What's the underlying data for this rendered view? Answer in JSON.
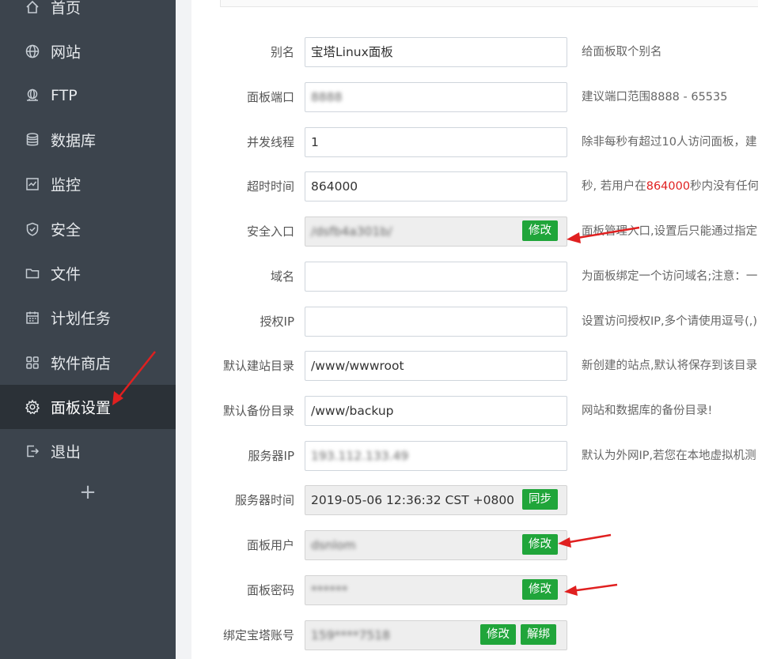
{
  "sidebar": {
    "items": [
      {
        "id": "home",
        "label": "首页",
        "icon": "home-icon"
      },
      {
        "id": "site",
        "label": "网站",
        "icon": "globe-icon"
      },
      {
        "id": "ftp",
        "label": "FTP",
        "icon": "ftp-icon"
      },
      {
        "id": "db",
        "label": "数据库",
        "icon": "database-icon"
      },
      {
        "id": "monitor",
        "label": "监控",
        "icon": "monitor-icon"
      },
      {
        "id": "security",
        "label": "安全",
        "icon": "shield-icon"
      },
      {
        "id": "files",
        "label": "文件",
        "icon": "folder-icon"
      },
      {
        "id": "cron",
        "label": "计划任务",
        "icon": "calendar-icon"
      },
      {
        "id": "store",
        "label": "软件商店",
        "icon": "grid-icon"
      },
      {
        "id": "settings",
        "label": "面板设置",
        "icon": "gear-icon",
        "active": true
      },
      {
        "id": "logout",
        "label": "退出",
        "icon": "logout-icon"
      }
    ],
    "plus": "+"
  },
  "form": {
    "alias": {
      "label": "别名",
      "value": "宝塔Linux面板",
      "hint": "给面板取个别名"
    },
    "port": {
      "label": "面板端口",
      "value": "8888",
      "hint": "建议端口范围8888 - 65535"
    },
    "threads": {
      "label": "并发线程",
      "value": "1",
      "hint": "除非每秒有超过10人访问面板，建"
    },
    "timeout": {
      "label": "超时时间",
      "value": "864000",
      "hint_pre": "秒, 若用户在",
      "hint_red": "864000",
      "hint_post": "秒内没有任何"
    },
    "entry": {
      "label": "安全入口",
      "value": "/dsfb4a301b/",
      "hint": "面板管理入口,设置后只能通过指定",
      "btn": "修改"
    },
    "domain": {
      "label": "域名",
      "value": "",
      "hint": "为面板绑定一个访问域名;注意：一"
    },
    "authip": {
      "label": "授权IP",
      "value": "",
      "hint": "设置访问授权IP,多个请使用逗号(,)"
    },
    "sitedir": {
      "label": "默认建站目录",
      "value": "/www/wwwroot",
      "hint": "新创建的站点,默认将保存到该目录"
    },
    "backupdir": {
      "label": "默认备份目录",
      "value": "/www/backup",
      "hint": "网站和数据库的备份目录!"
    },
    "serverip": {
      "label": "服务器IP",
      "value": "193.112.133.49",
      "hint": "默认为外网IP,若您在本地虚拟机测"
    },
    "servertime": {
      "label": "服务器时间",
      "value": "2019-05-06 12:36:32 CST +0800",
      "btn": "同步"
    },
    "user": {
      "label": "面板用户",
      "value": "dsnlom",
      "btn": "修改"
    },
    "password": {
      "label": "面板密码",
      "value": "******",
      "btn": "修改"
    },
    "account": {
      "label": "绑定宝塔账号",
      "value": "159****7518",
      "btn_edit": "修改",
      "btn_unbind": "解绑"
    }
  },
  "colors": {
    "sidebar": "#3c444d",
    "active": "#2b3137",
    "accent": "#20a53a",
    "arrow": "#e02020"
  }
}
